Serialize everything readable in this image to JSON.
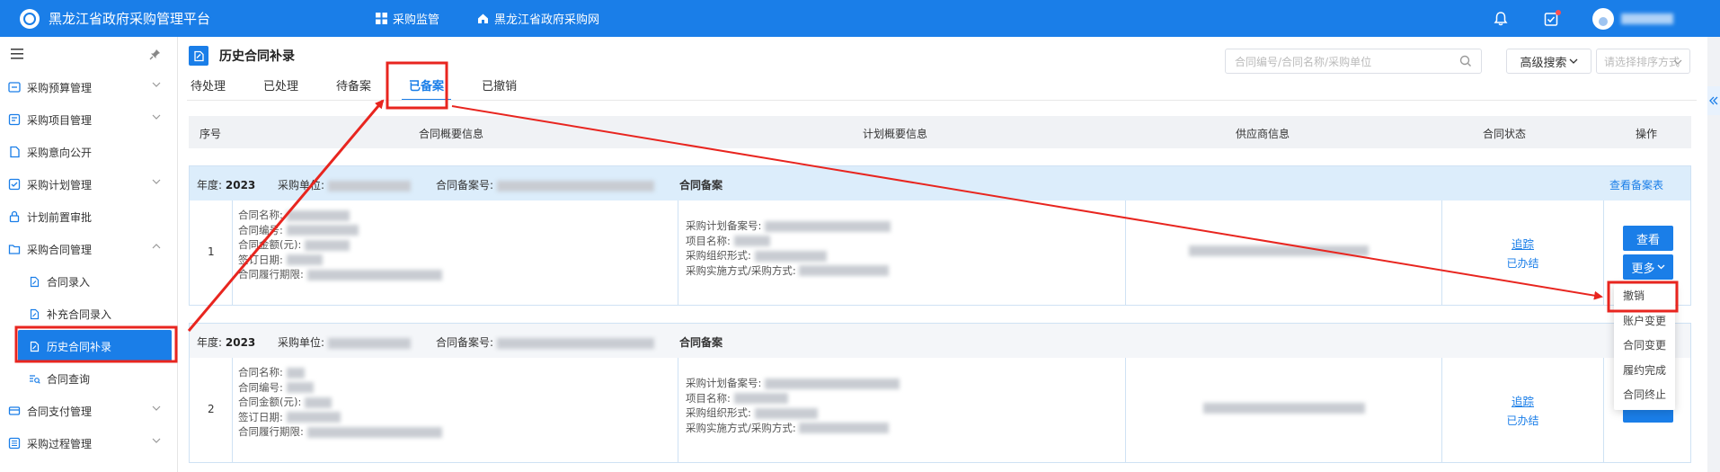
{
  "topbar": {
    "title": "黑龙江省政府采购管理平台",
    "nav": [
      {
        "label": "采购监管",
        "icon": "grid-icon"
      },
      {
        "label": "黑龙江省政府采购网",
        "icon": "home-icon"
      }
    ]
  },
  "sidebar": {
    "items": [
      {
        "label": "采购预算管理"
      },
      {
        "label": "采购项目管理"
      },
      {
        "label": "采购意向公开"
      },
      {
        "label": "采购计划管理"
      },
      {
        "label": "计划前置审批"
      },
      {
        "label": "采购合同管理"
      },
      {
        "label": "合同录入"
      },
      {
        "label": "补充合同录入"
      },
      {
        "label": "历史合同补录"
      },
      {
        "label": "合同查询"
      },
      {
        "label": "合同支付管理"
      },
      {
        "label": "采购过程管理"
      }
    ]
  },
  "page": {
    "title": "历史合同补录",
    "tabs": [
      "待处理",
      "已处理",
      "待备案",
      "已备案",
      "已撤销"
    ],
    "active_tab": "已备案",
    "search_placeholder": "合同编号/合同名称/采购单位",
    "advanced_search": "高级搜索",
    "sort_placeholder": "请选择排序方式"
  },
  "table": {
    "headers": [
      "序号",
      "合同概要信息",
      "计划概要信息",
      "供应商信息",
      "合同状态",
      "操作"
    ],
    "rows": [
      {
        "year_label": "年度:",
        "year": "2023",
        "unit_label": "采购单位:",
        "record_label": "合同备案号:",
        "type": "合同备案",
        "view_record": "查看备案表",
        "index": "1",
        "contract_fields": [
          "合同名称:",
          "合同编号:",
          "合同金额(元):",
          "签订日期:",
          "合同履行期限:"
        ],
        "plan_fields": [
          "采购计划备案号:",
          "项目名称:",
          "采购组织形式:",
          "采购实施方式/采购方式:"
        ],
        "status_link": "追踪",
        "status": "已办结",
        "btn_view": "查看",
        "btn_more": "更多"
      },
      {
        "year_label": "年度:",
        "year": "2023",
        "unit_label": "采购单位:",
        "record_label": "合同备案号:",
        "type": "合同备案",
        "index": "2",
        "contract_fields": [
          "合同名称:",
          "合同编号:",
          "合同金额(元):",
          "签订日期:",
          "合同履行期限:"
        ],
        "plan_fields": [
          "采购计划备案号:",
          "项目名称:",
          "采购组织形式:",
          "采购实施方式/采购方式:"
        ],
        "status_link": "追踪",
        "status": "已办结"
      }
    ]
  },
  "dropdown": {
    "items": [
      "撤销",
      "账户变更",
      "合同变更",
      "履约完成",
      "合同终止"
    ]
  },
  "colors": {
    "primary": "#1a7ee8",
    "annotation": "#e8251f"
  }
}
